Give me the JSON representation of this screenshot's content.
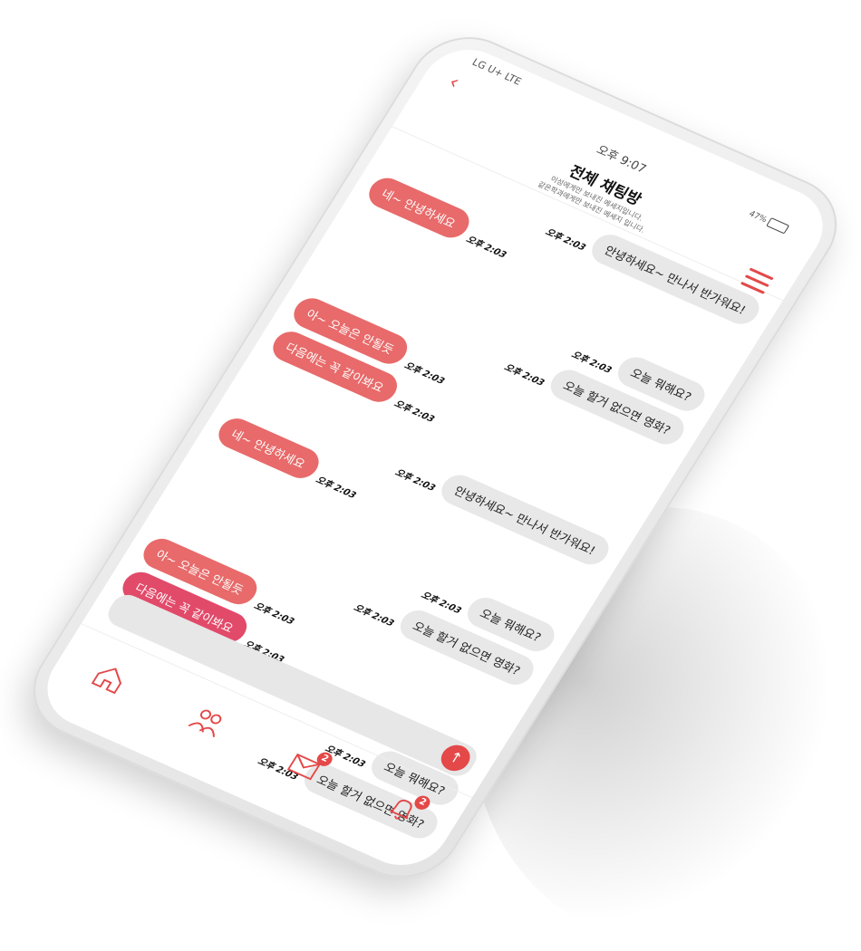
{
  "status": {
    "carrier": "LG U+ LTE",
    "battery": "47%"
  },
  "header": {
    "time": "오후 9:07",
    "title": "전체 채팅방",
    "subtitle_line1": "이성에게만 보내진 메세지입니다.",
    "subtitle_line2": "같은학과에게만 보내진 메세지 입니다."
  },
  "messages": [
    {
      "side": "right",
      "tone": "gray",
      "text": "안녕하세요~ 만나서 반가워요!",
      "time": "오후 2:03"
    },
    {
      "side": "left",
      "tone": "red",
      "text": "네~ 안녕하세요",
      "time": "오후 2:03"
    },
    {
      "side": "right",
      "tone": "gray",
      "text": "오늘 뭐해요?",
      "time": "오후 2:03",
      "gap": true
    },
    {
      "side": "right",
      "tone": "gray",
      "text": "오늘 할거 없으면 영화?",
      "time": "오후 2:03"
    },
    {
      "side": "left",
      "tone": "red",
      "text": "아~ 오늘은 안될듯",
      "time": "오후 2:03"
    },
    {
      "side": "left",
      "tone": "red",
      "text": "다음에는 꼭 같이봐요",
      "time": "오후 2:03"
    },
    {
      "side": "right",
      "tone": "gray",
      "text": "안녕하세요~ 만나서 반가워요!",
      "time": "오후 2:03",
      "gap": true
    },
    {
      "side": "left",
      "tone": "red",
      "text": "네~ 안녕하세요",
      "time": "오후 2:03"
    },
    {
      "side": "right",
      "tone": "gray",
      "text": "오늘 뭐해요?",
      "time": "오후 2:03",
      "gap": true
    },
    {
      "side": "right",
      "tone": "gray",
      "text": "오늘 할거 없으면 영화?",
      "time": "오후 2:03"
    },
    {
      "side": "left",
      "tone": "red",
      "text": "아~ 오늘은 안될듯",
      "time": "오후 2:03"
    },
    {
      "side": "left",
      "tone": "red-dark",
      "text": "다음에는 꼭 같이봐요",
      "time": "오후 2:03"
    },
    {
      "side": "right",
      "tone": "gray",
      "text": "오늘 뭐해요?",
      "time": "오후 2:03",
      "gap": true
    },
    {
      "side": "right",
      "tone": "gray",
      "text": "오늘 할거 없으면 영화?",
      "time": "오후 2:03"
    }
  ],
  "input": {
    "placeholder": ""
  },
  "tabs": [
    {
      "name": "home",
      "icon": "home-icon",
      "badge": ""
    },
    {
      "name": "friends",
      "icon": "people-icon",
      "badge": ""
    },
    {
      "name": "messages",
      "icon": "envelope-icon",
      "badge": "2"
    },
    {
      "name": "notifications",
      "icon": "bell-icon",
      "badge": "2"
    }
  ],
  "colors": {
    "accent": "#e44848",
    "bubble_red": "#e86a6a",
    "bubble_gray": "#e8e8e8"
  }
}
